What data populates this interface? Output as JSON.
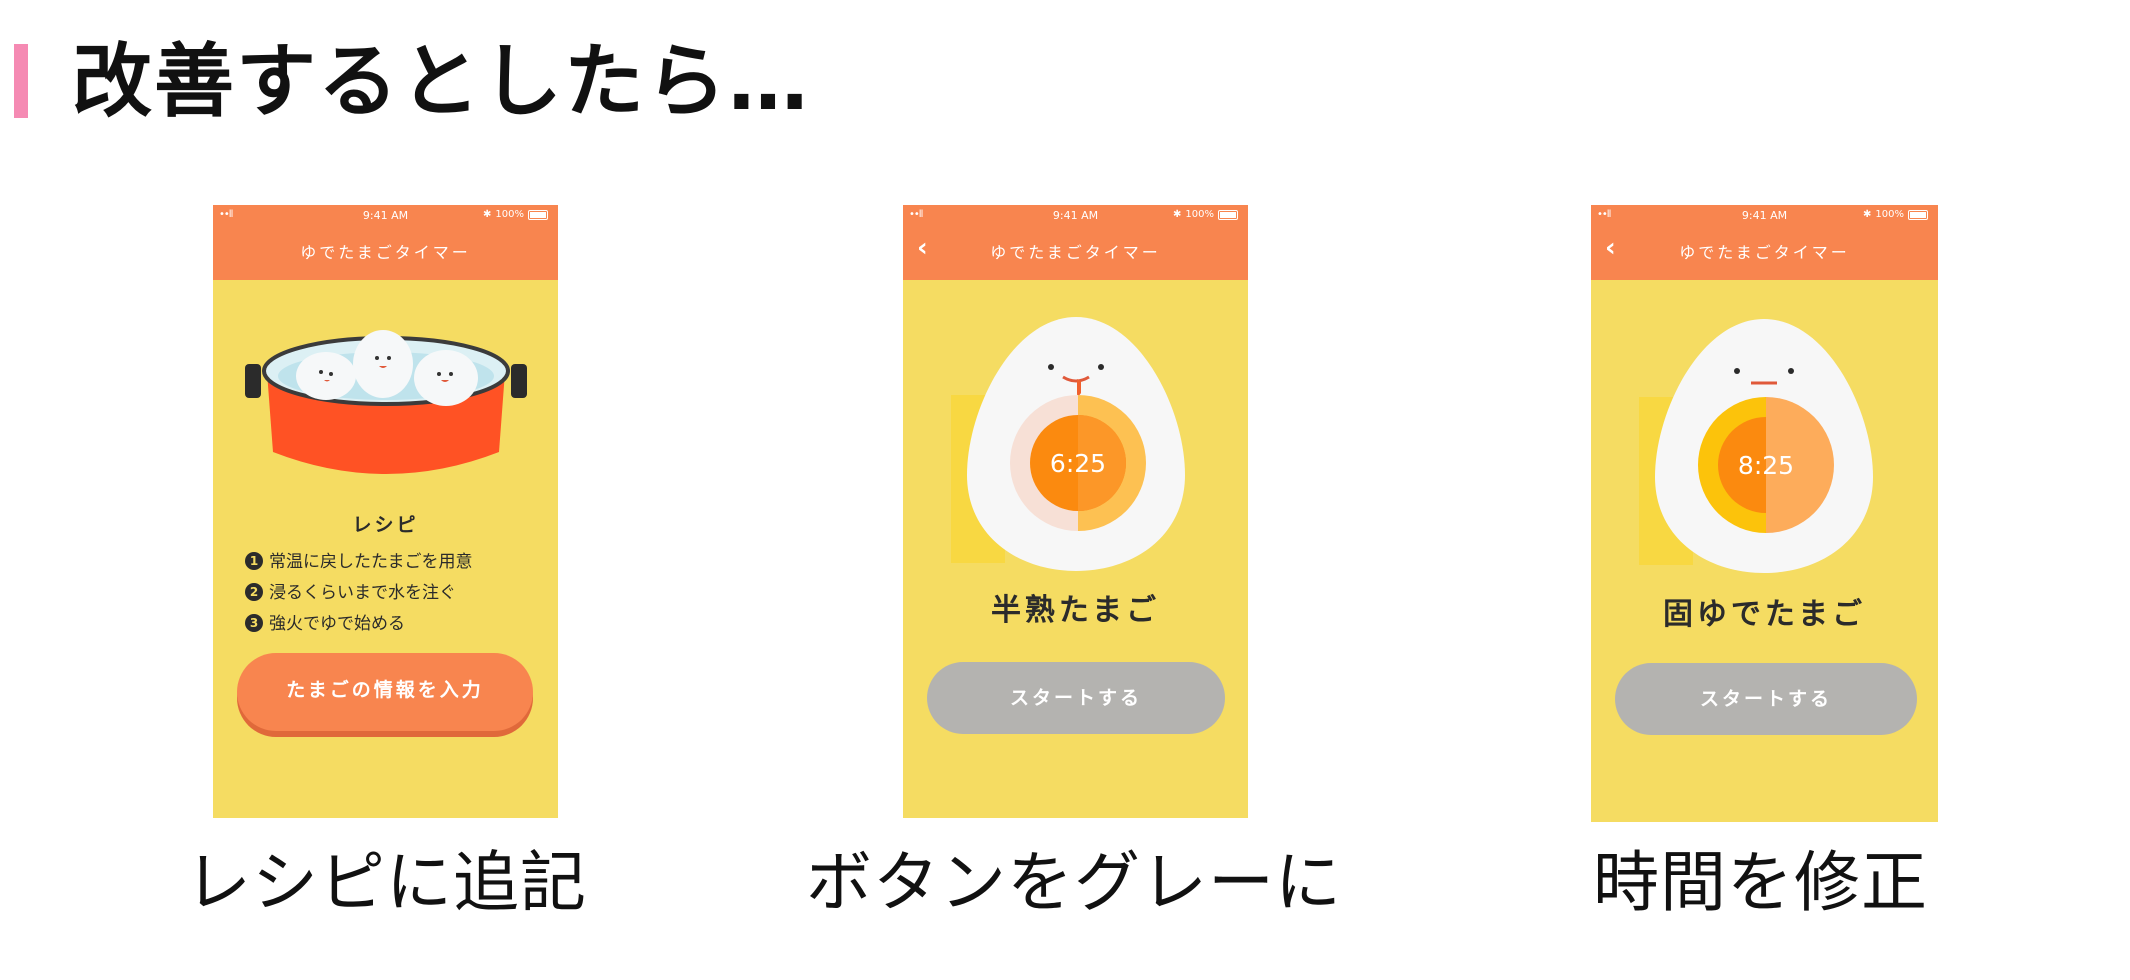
{
  "slide": {
    "title": "改善するとしたら…"
  },
  "screens": [
    {
      "status": {
        "signal": "••ll",
        "time": "9:41 AM",
        "battery": "100%"
      },
      "nav_title": "ゆでたまごタイマー",
      "recipe_title": "レシピ",
      "steps": [
        {
          "num": "1",
          "text": "常温に戻したたまごを用意"
        },
        {
          "num": "2",
          "text": "浸るくらいまで水を注ぐ"
        },
        {
          "num": "3",
          "text": "強火でゆで始める"
        }
      ],
      "button": "たまごの情報を入力",
      "caption": "レシピに追記"
    },
    {
      "status": {
        "signal": "••ll",
        "time": "9:41 AM",
        "battery": "100%"
      },
      "nav_title": "ゆでたまごタイマー",
      "back": "‹",
      "timer": "6:25",
      "egg_name": "半熟たまご",
      "button": "スタートする",
      "caption": "ボタンをグレーに",
      "colors": {
        "yolk": "#fb8a0f",
        "yolk_half": "#fdc152",
        "ring_left": "#f7e0d6"
      }
    },
    {
      "status": {
        "signal": "••ll",
        "time": "9:41 AM",
        "battery": "100%"
      },
      "nav_title": "ゆでたまごタイマー",
      "back": "‹",
      "timer": "8:25",
      "egg_name": "固ゆでたまご",
      "button": "スタートする",
      "caption": "時間を修正",
      "colors": {
        "yolk": "#fb8a0f",
        "yolk_half": "#fdac5b",
        "ring_left": "#fcc30b"
      }
    }
  ]
}
